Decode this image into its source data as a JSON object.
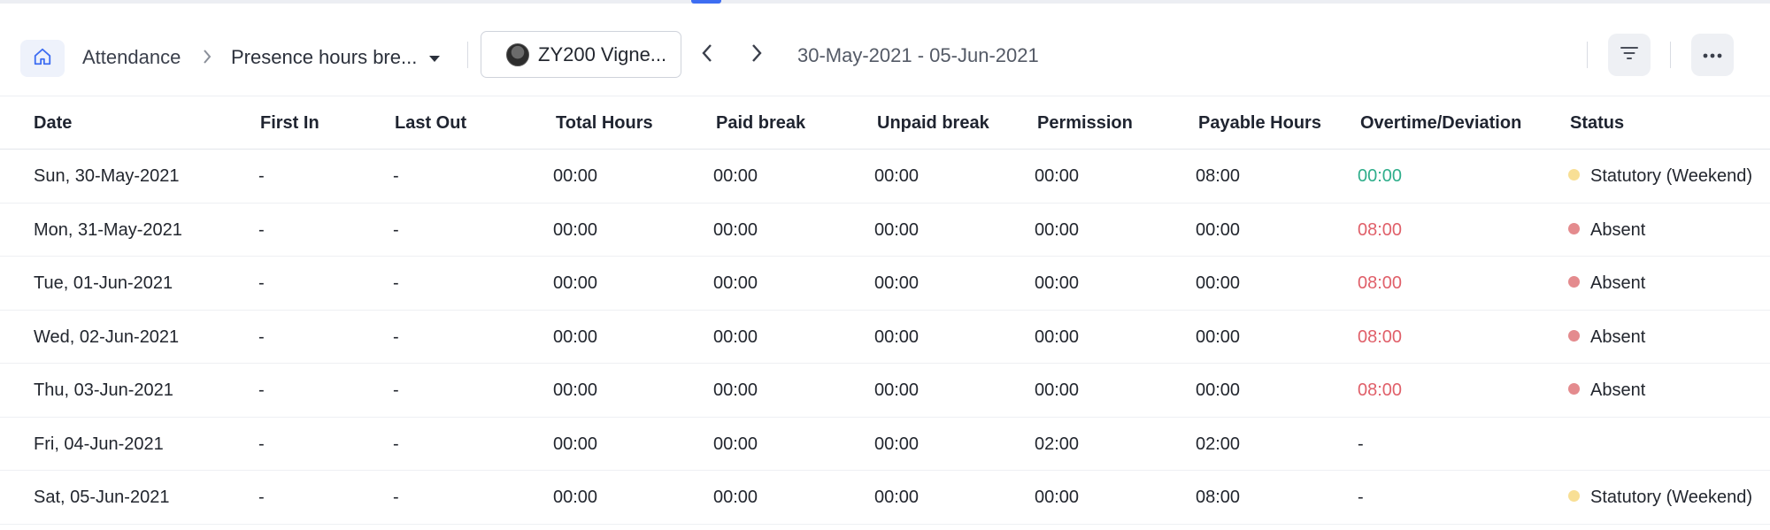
{
  "breadcrumb": {
    "root": "Attendance",
    "current": "Presence hours bre..."
  },
  "employee": {
    "label": "ZY200 Vigne..."
  },
  "date_range": "30-May-2021 - 05-Jun-2021",
  "colors": {
    "accent": "#3d6df2",
    "positive": "#2fae8b",
    "negative": "#e0606a",
    "weekend_dot": "#f8df95",
    "absent_dot": "#e48b8e"
  },
  "table": {
    "columns": [
      "Date",
      "First In",
      "Last Out",
      "Total Hours",
      "Paid break",
      "Unpaid break",
      "Permission",
      "Payable Hours",
      "Overtime/Deviation",
      "Status"
    ],
    "rows": [
      {
        "date": "Sun, 30-May-2021",
        "first_in": "-",
        "last_out": "-",
        "total_hours": "00:00",
        "paid_break": "00:00",
        "unpaid_break": "00:00",
        "permission": "00:00",
        "payable_hours": "08:00",
        "overtime": "00:00",
        "overtime_tone": "positive",
        "status": "Statutory (Weekend)",
        "status_type": "weekend"
      },
      {
        "date": "Mon, 31-May-2021",
        "first_in": "-",
        "last_out": "-",
        "total_hours": "00:00",
        "paid_break": "00:00",
        "unpaid_break": "00:00",
        "permission": "00:00",
        "payable_hours": "00:00",
        "overtime": "08:00",
        "overtime_tone": "negative",
        "status": "Absent",
        "status_type": "absent"
      },
      {
        "date": "Tue, 01-Jun-2021",
        "first_in": "-",
        "last_out": "-",
        "total_hours": "00:00",
        "paid_break": "00:00",
        "unpaid_break": "00:00",
        "permission": "00:00",
        "payable_hours": "00:00",
        "overtime": "08:00",
        "overtime_tone": "negative",
        "status": "Absent",
        "status_type": "absent"
      },
      {
        "date": "Wed, 02-Jun-2021",
        "first_in": "-",
        "last_out": "-",
        "total_hours": "00:00",
        "paid_break": "00:00",
        "unpaid_break": "00:00",
        "permission": "00:00",
        "payable_hours": "00:00",
        "overtime": "08:00",
        "overtime_tone": "negative",
        "status": "Absent",
        "status_type": "absent"
      },
      {
        "date": "Thu, 03-Jun-2021",
        "first_in": "-",
        "last_out": "-",
        "total_hours": "00:00",
        "paid_break": "00:00",
        "unpaid_break": "00:00",
        "permission": "00:00",
        "payable_hours": "00:00",
        "overtime": "08:00",
        "overtime_tone": "negative",
        "status": "Absent",
        "status_type": "absent"
      },
      {
        "date": "Fri, 04-Jun-2021",
        "first_in": "-",
        "last_out": "-",
        "total_hours": "00:00",
        "paid_break": "00:00",
        "unpaid_break": "00:00",
        "permission": "02:00",
        "payable_hours": "02:00",
        "overtime": "-",
        "overtime_tone": "neutral",
        "status": "",
        "status_type": "none"
      },
      {
        "date": "Sat, 05-Jun-2021",
        "first_in": "-",
        "last_out": "-",
        "total_hours": "00:00",
        "paid_break": "00:00",
        "unpaid_break": "00:00",
        "permission": "00:00",
        "payable_hours": "08:00",
        "overtime": "-",
        "overtime_tone": "neutral",
        "status": "Statutory (Weekend)",
        "status_type": "weekend"
      }
    ]
  }
}
